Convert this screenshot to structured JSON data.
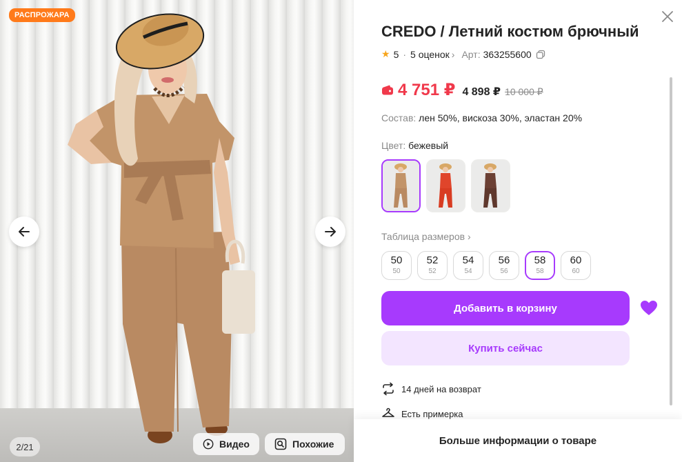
{
  "gallery": {
    "badge": "РАСПРОЖАРА",
    "counter": "2/21",
    "video_label": "Видео",
    "similar_label": "Похожие"
  },
  "product": {
    "title": "CREDO / Летний костюм брючный",
    "rating": "5",
    "separator": "·",
    "reviews": "5 оценок",
    "article_label": "Арт:",
    "article": "363255600",
    "price": "4 751 ₽",
    "price_mid": "4 898 ₽",
    "price_old": "10 000 ₽",
    "composition_label": "Состав:",
    "composition": "лен 50%, вискоза 30%, эластан 20%",
    "color_label": "Цвет:",
    "color": "бежевый",
    "size_table": "Таблица размеров",
    "sizes": [
      {
        "size": "50",
        "ru": "50"
      },
      {
        "size": "52",
        "ru": "52"
      },
      {
        "size": "54",
        "ru": "54"
      },
      {
        "size": "56",
        "ru": "56"
      },
      {
        "size": "58",
        "ru": "58"
      },
      {
        "size": "60",
        "ru": "60"
      }
    ],
    "selected_size": "58",
    "add_to_cart": "Добавить в корзину",
    "buy_now": "Купить сейчас",
    "perk_return": "14 дней на возврат",
    "perk_fitting": "Есть примерка",
    "more_info": "Больше информации о товаре"
  },
  "colors": {
    "accent": "#a73afd",
    "accent_light": "#f3e5ff",
    "price": "#f0394b",
    "badge": "#ff7a1a",
    "star": "#f7a51c"
  },
  "icons": {
    "close": "close-icon",
    "wallet": "wallet-icon",
    "copy": "copy-icon",
    "heart": "heart-icon",
    "return": "return-arrows-icon",
    "hanger": "hanger-icon",
    "play": "play-icon",
    "search": "search-icon",
    "arrow_left": "arrow-left-icon",
    "arrow_right": "arrow-right-icon"
  }
}
